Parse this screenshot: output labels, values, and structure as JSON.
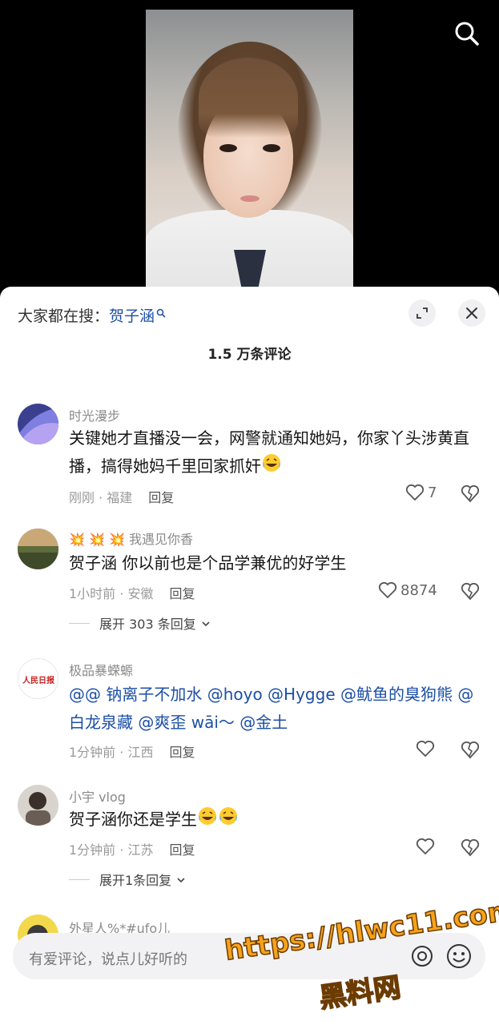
{
  "hot_search": {
    "prefix": "大家都在搜：",
    "keyword": "贺子涵"
  },
  "comment_count": "1.5 万条评论",
  "comments": [
    {
      "user": "时光漫步",
      "text": "关键她才直播没一会，网警就通知她妈，你家丫头涉黄直播，搞得她妈千里回家抓奸",
      "meta": "刚刚 · 福建",
      "reply": "回复",
      "likes": "7"
    },
    {
      "user": "💥 💥 💥 我遇见你香",
      "text": "贺子涵 你以前也是个品学兼优的好学生",
      "meta": "1小时前 · 安徽",
      "reply": "回复",
      "likes": "8874",
      "expand": "展开 303 条回复"
    },
    {
      "user": "极品暴蝾螈",
      "text_parts": [
        "@@ 钠离子不加水 @hoyo @Hygge @鱿鱼的臭狗熊 @白龙泉藏 @爽歪 wāi～ @金土"
      ],
      "meta": "1分钟前 · 江西",
      "reply": "回复",
      "likes": "",
      "avatar_text": "人民日报"
    },
    {
      "user": "小宇 vlog",
      "text": "贺子涵你还是学生",
      "meta": "1分钟前 · 江苏",
      "reply": "回复",
      "likes": "",
      "expand": "展开1条回复"
    },
    {
      "user": "外星人%*#ufo儿"
    }
  ],
  "input": {
    "placeholder": "有爱评论，说点儿好听的"
  },
  "watermark": {
    "line1": "https://hlwc11.com",
    "line2": "黑料网"
  },
  "colors": {
    "link": "#1c4fa6",
    "watermark": "#f6a21b"
  },
  "icons": [
    "search-icon",
    "expand-icon",
    "close-icon",
    "heart-icon",
    "broken-heart-icon",
    "chevron-down-icon",
    "at-icon",
    "emoji-icon"
  ]
}
